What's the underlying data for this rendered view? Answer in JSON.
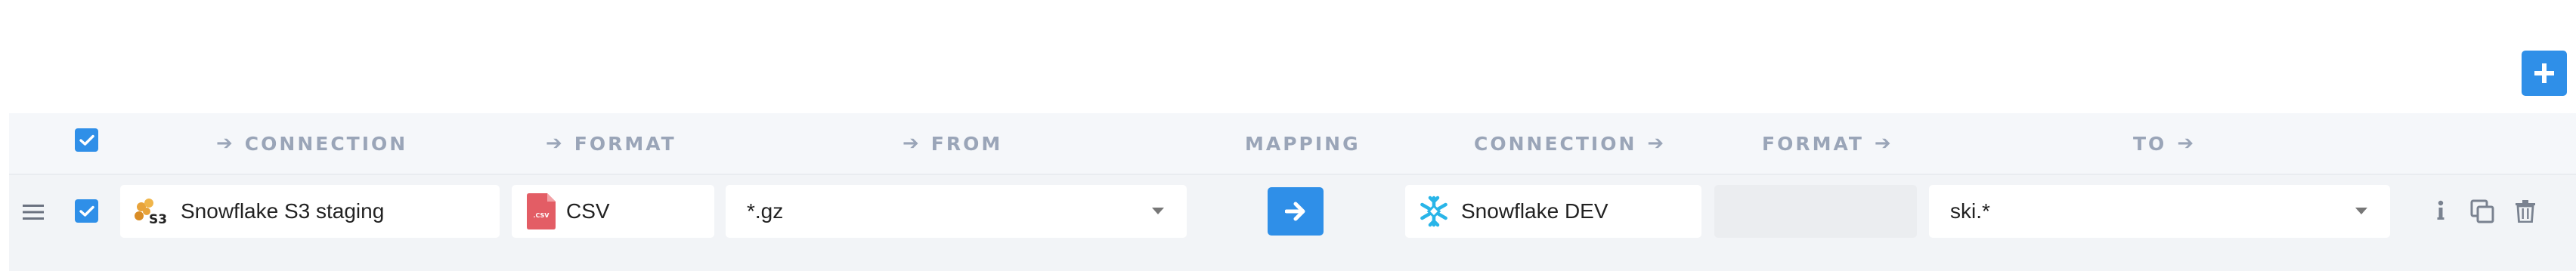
{
  "toolbar": {
    "add_button_icon": "plus-icon"
  },
  "header": {
    "select_all_checked": true,
    "source_connection": "CONNECTION",
    "source_format": "FORMAT",
    "source_from": "FROM",
    "mapping": "MAPPING",
    "target_connection": "CONNECTION",
    "target_format": "FORMAT",
    "target_to": "TO"
  },
  "row": {
    "checked": true,
    "source_connection": {
      "label": "Snowflake S3 staging",
      "icon": "aws-s3-icon"
    },
    "source_format": {
      "label": "CSV",
      "icon": "csv-file-icon",
      "icon_text": ".CSV"
    },
    "source_from": {
      "value": "*.gz"
    },
    "mapping_icon": "arrow-right-icon",
    "target_connection": {
      "label": "Snowflake DEV",
      "icon": "snowflake-icon"
    },
    "target_format": {
      "value": ""
    },
    "target_to": {
      "value": "ski.*"
    },
    "actions": [
      "info-icon",
      "copy-icon",
      "trash-icon"
    ]
  },
  "colors": {
    "accent": "#2f8fe8",
    "header_text": "#9aa5b8",
    "row_background": "#f2f4f7",
    "csv_icon": "#e35d65",
    "snowflake_icon": "#29b5e8",
    "s3_icon": "#e8a33a"
  }
}
